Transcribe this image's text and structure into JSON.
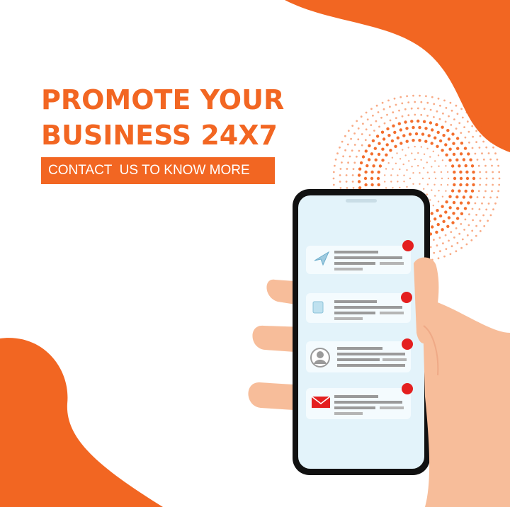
{
  "headline": {
    "line1": "PROMOTE YOUR",
    "line2": "BUSINESS 24X7"
  },
  "cta": {
    "label": "CONTACT  US TO KNOW MORE"
  },
  "colors": {
    "accent": "#f26622",
    "skin": "#f7bd9a",
    "screen": "#e3f3fa",
    "notification_dot": "#e41f1f"
  },
  "phone": {
    "notifications": [
      {
        "icon": "paper-plane-icon"
      },
      {
        "icon": "document-icon"
      },
      {
        "icon": "user-avatar-icon"
      },
      {
        "icon": "mail-envelope-icon"
      }
    ]
  }
}
